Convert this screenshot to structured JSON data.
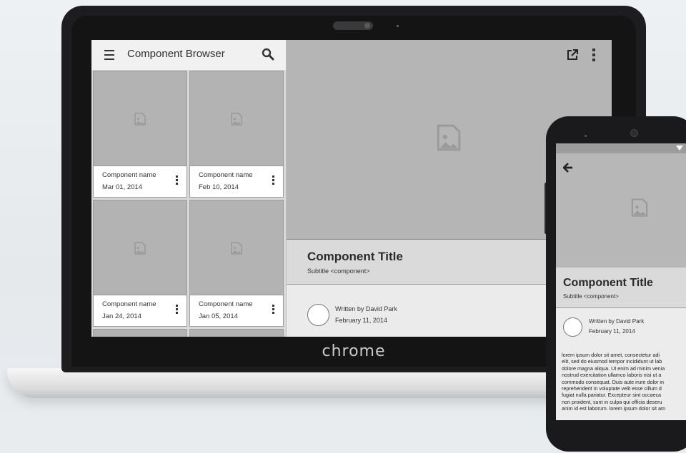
{
  "laptop": {
    "brand_label": "chrome"
  },
  "app": {
    "title": "Component Browser"
  },
  "cards": [
    {
      "name": "Component name",
      "date": "Mar 01, 2014"
    },
    {
      "name": "Component name",
      "date": "Feb 10, 2014"
    },
    {
      "name": "Component name",
      "date": "Jan 24, 2014"
    },
    {
      "name": "Component name",
      "date": "Jan 05, 2014"
    }
  ],
  "detail": {
    "title": "Component Title",
    "subtitle": "Subtitle <component>",
    "byline": "Written by David Park",
    "date": "February 11, 2014"
  },
  "phone": {
    "back_icon": "arrow-left-icon",
    "title": "Component Title",
    "subtitle": "Subtitle <component>",
    "byline": "Written by David Park",
    "date": "February 11, 2014",
    "body_lines": [
      "lorem ipsum dolor sit amet, consectetur adi",
      "elit, sed do eiusmod tempor incididunt ut lab",
      "dolore magna aliqua. Ut enim ad minim venia",
      "nostrud exercitation ullamco laboris nisi ut a",
      "commodo consequat. Duis aute irure dolor in",
      "reprehenderit in voluptate velit esse cillum d",
      "fugiat nulla pariatur. Excepteur sint occaeca",
      "non proident, sunt in culpa qui officia deseru",
      "anim id est laborum. lorem ipsum dolor sit am"
    ]
  },
  "icons": [
    "menu-icon",
    "search-icon",
    "image-placeholder-icon",
    "more-vert-icon",
    "open-in-new-icon",
    "arrow-left-icon",
    "wifi-icon"
  ],
  "colors": {
    "placeholder_gray": "#b5b5b5",
    "bezel": "#1d1d1f"
  }
}
